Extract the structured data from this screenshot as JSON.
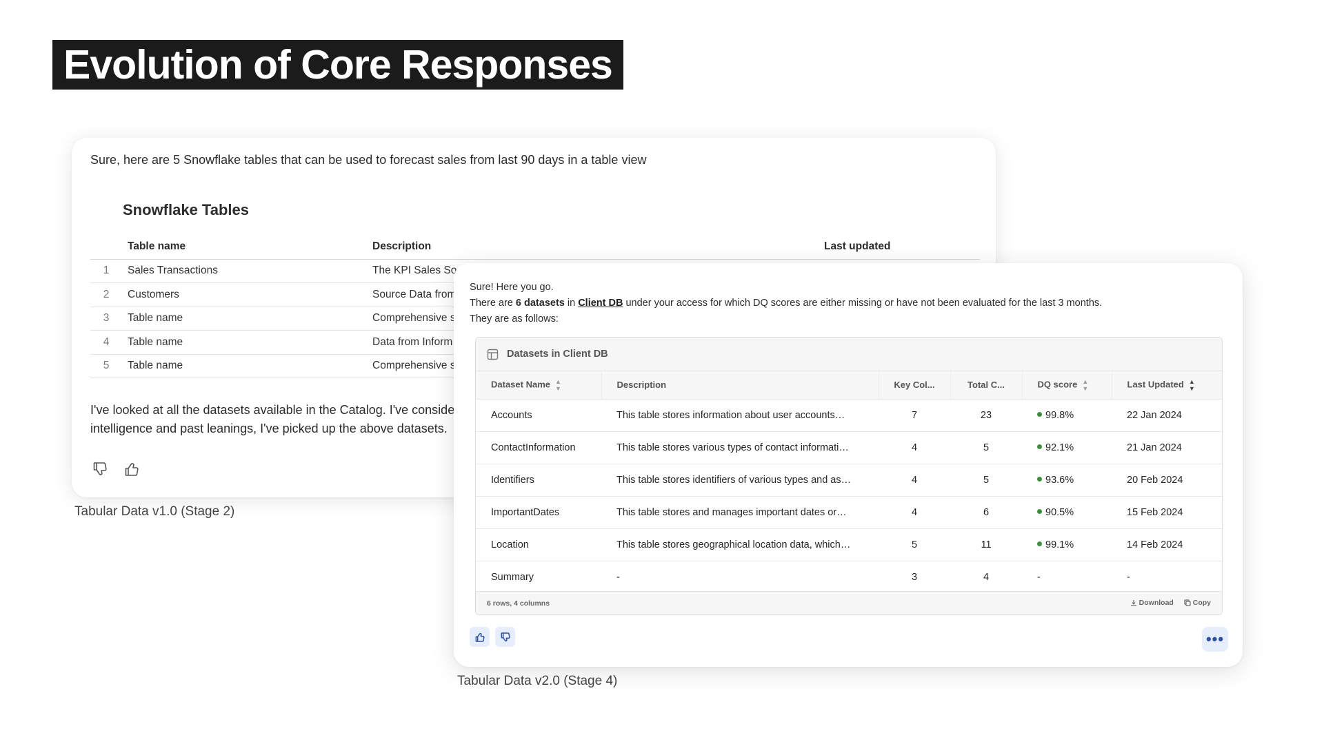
{
  "slide": {
    "title": "Evolution of Core Responses"
  },
  "v1": {
    "intro": "Sure, here are 5 Snowflake tables that can be used to forecast sales from last 90 days in a table view",
    "table_title": "Snowflake Tables",
    "columns": [
      "Table name",
      "Description",
      "Last updated"
    ],
    "rows": [
      {
        "num": "1",
        "name": "Sales Transactions",
        "desc": "The KPI Sales So"
      },
      {
        "num": "2",
        "name": "Customers",
        "desc": "Source Data from"
      },
      {
        "num": "3",
        "name": "Table name",
        "desc": "Comprehensive s"
      },
      {
        "num": "4",
        "name": "Table name",
        "desc": "Data from Inform"
      },
      {
        "num": "5",
        "name": "Table name",
        "desc": "Comprehensive s"
      }
    ],
    "outro_line1": "I've looked at all the datasets available in the Catalog. I've consider",
    "outro_line2": "intelligence and past leanings, I've picked up the above datasets.",
    "caption": "Tabular Data v1.0 (Stage 2)"
  },
  "v2": {
    "line1": "Sure! Here you go.",
    "line2_pre": "There are ",
    "line2_count": "6 datasets",
    "line2_mid": " in ",
    "line2_link": "Client DB",
    "line2_post": " under your access for which DQ scores are either missing or have not been evaluated for the last 3 months.",
    "line3": "They are as follows:",
    "table_title": "Datasets in Client DB",
    "columns": {
      "name": "Dataset Name",
      "desc": "Description",
      "key": "Key Col...",
      "total": "Total C...",
      "dq": "DQ score",
      "updated": "Last Updated"
    },
    "rows": [
      {
        "name": "Accounts",
        "desc": "This table stores information about user accounts…",
        "key": "7",
        "total": "23",
        "dq": "99.8%",
        "updated": "22 Jan 2024"
      },
      {
        "name": "ContactInformation",
        "desc": "This table stores various types of contact informati…",
        "key": "4",
        "total": "5",
        "dq": "92.1%",
        "updated": "21 Jan 2024"
      },
      {
        "name": "Identifiers",
        "desc": "This table stores identifiers of various types and as…",
        "key": "4",
        "total": "5",
        "dq": "93.6%",
        "updated": "20 Feb 2024"
      },
      {
        "name": "ImportantDates",
        "desc": "This table stores and manages important dates or…",
        "key": "4",
        "total": "6",
        "dq": "90.5%",
        "updated": "15 Feb 2024"
      },
      {
        "name": "Location",
        "desc": "This table stores geographical location data, which…",
        "key": "5",
        "total": "11",
        "dq": "99.1%",
        "updated": "14 Feb 2024"
      },
      {
        "name": "Summary",
        "desc": "-",
        "key": "3",
        "total": "4",
        "dq": "-",
        "updated": "-"
      }
    ],
    "footer_info": "6 rows, 4 columns",
    "download_label": "Download",
    "copy_label": "Copy",
    "more_label": "•••",
    "caption": "Tabular Data v2.0 (Stage 4)",
    "colors": {
      "dq_dot": "#3e8e3e",
      "button_bg": "#e6eefb",
      "button_icon": "#2c4fa3"
    }
  }
}
